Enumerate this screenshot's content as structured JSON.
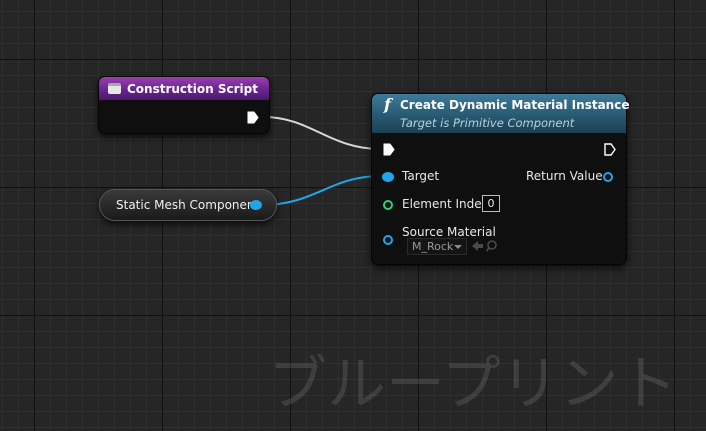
{
  "construction_node": {
    "title": "Construction Script",
    "header_color": "#6a2490"
  },
  "mesh_node": {
    "label": "Static Mesh Component",
    "pin_color": "#1fa7ea"
  },
  "create_node": {
    "title": "Create Dynamic Material Instance",
    "subtitle": "Target is Primitive Component",
    "header_color": "#285a72",
    "pins": {
      "target": "Target",
      "element_index": "Element Index",
      "element_index_value": "0",
      "source_material": "Source Material",
      "source_material_value": "M_Rock",
      "return_value": "Return Value"
    }
  },
  "wire_colors": {
    "exec": "#d8d8d8",
    "object": "#1fa7ea"
  },
  "watermark": "ブループリント"
}
